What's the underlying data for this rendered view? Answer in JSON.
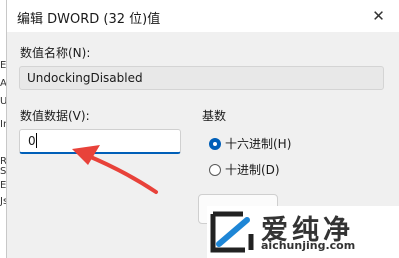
{
  "background": {
    "fragments": [
      "Ev",
      "Ar",
      "U",
      "In",
      "Re",
      "S",
      "Es",
      "Js"
    ]
  },
  "dialog": {
    "title": "编辑 DWORD (32 位)值",
    "close_icon": "close-icon",
    "value_name_label": "数值名称(N):",
    "value_name": "UndockingDisabled",
    "value_data_label": "数值数据(V):",
    "value_data": "0",
    "base_label": "基数",
    "radio_hex": "十六进制(H)",
    "radio_dec": "十进制(D)",
    "selected_base": "hex"
  },
  "watermark": {
    "brand": "爱纯净",
    "url": "aichunjing.com",
    "logo_icon": "slash-box-logo-icon"
  },
  "annotation": {
    "arrow_color": "#e8423a",
    "arrow_icon": "red-arrow-icon"
  },
  "colors": {
    "accent": "#005fb8"
  }
}
